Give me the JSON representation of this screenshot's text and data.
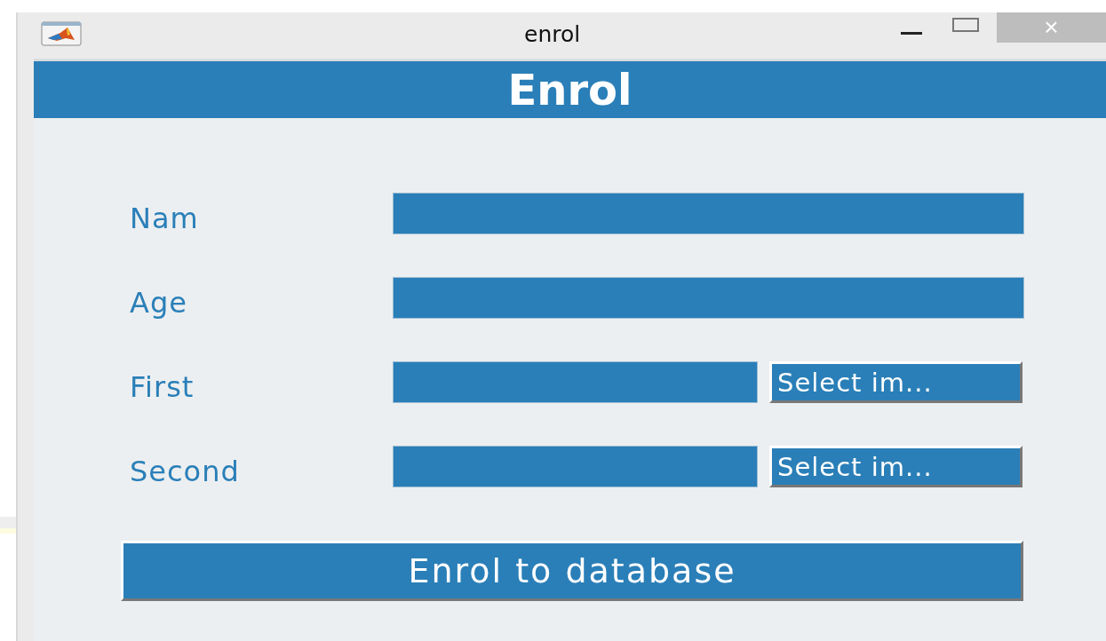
{
  "window": {
    "title": "enrol",
    "close": "×"
  },
  "header": "Enrol",
  "fields": [
    {
      "label": "Nam",
      "kind": "text"
    },
    {
      "label": "Age",
      "kind": "text"
    },
    {
      "label": "First",
      "kind": "image",
      "button": "Select im..."
    },
    {
      "label": "Second",
      "kind": "image",
      "button": "Select im..."
    }
  ],
  "submit": "Enrol to database"
}
